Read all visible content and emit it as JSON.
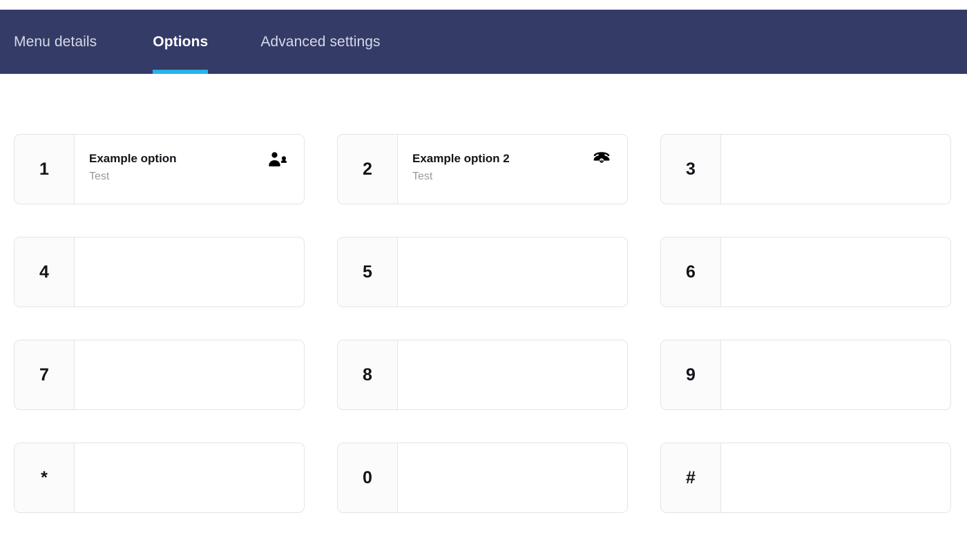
{
  "colors": {
    "tabbar_background": "#343b67",
    "tab_active_underline": "#27b4ea",
    "tab_inactive_text": "#d7d9e6",
    "tab_active_text": "#ffffff",
    "card_border": "#e4e4e6",
    "card_key_background": "#fbfbfb",
    "card_body_background": "#ffffff",
    "title_text": "#14131a",
    "subtitle_text": "#9a9a9e",
    "page_background": "#ffffff"
  },
  "tabs": [
    {
      "label": "Menu details",
      "active": false
    },
    {
      "label": "Options",
      "active": true
    },
    {
      "label": "Advanced settings",
      "active": false
    }
  ],
  "options": [
    {
      "key": "1",
      "title": "Example option",
      "subtitle": "Test",
      "icon": "users-icon"
    },
    {
      "key": "2",
      "title": "Example option 2",
      "subtitle": "Test",
      "icon": "telephone-icon"
    },
    {
      "key": "3",
      "title": "",
      "subtitle": "",
      "icon": ""
    },
    {
      "key": "4",
      "title": "",
      "subtitle": "",
      "icon": ""
    },
    {
      "key": "5",
      "title": "",
      "subtitle": "",
      "icon": ""
    },
    {
      "key": "6",
      "title": "",
      "subtitle": "",
      "icon": ""
    },
    {
      "key": "7",
      "title": "",
      "subtitle": "",
      "icon": ""
    },
    {
      "key": "8",
      "title": "",
      "subtitle": "",
      "icon": ""
    },
    {
      "key": "9",
      "title": "",
      "subtitle": "",
      "icon": ""
    },
    {
      "key": "*",
      "title": "",
      "subtitle": "",
      "icon": ""
    },
    {
      "key": "0",
      "title": "",
      "subtitle": "",
      "icon": ""
    },
    {
      "key": "#",
      "title": "",
      "subtitle": "",
      "icon": ""
    }
  ]
}
